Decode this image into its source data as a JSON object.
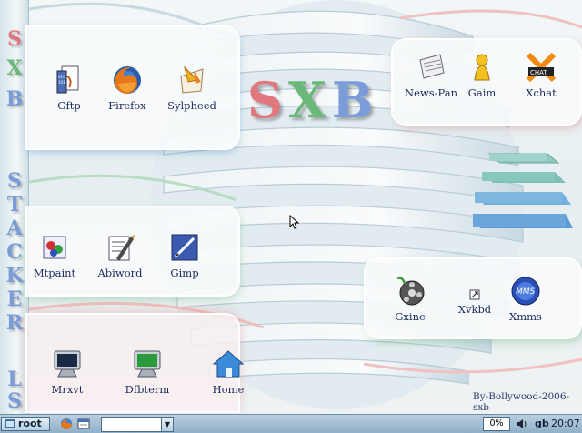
{
  "sidebar": {
    "letters": [
      "S",
      "X",
      "B",
      "S",
      "T",
      "A",
      "C",
      "K",
      "E",
      "R",
      "L",
      "S"
    ]
  },
  "logo": {
    "letters": [
      "S",
      "X",
      "B"
    ],
    "colors": [
      "#e07880",
      "#6cb87a",
      "#7a9cd8"
    ]
  },
  "panels": {
    "top_left": [
      {
        "label": "Gftp",
        "icon": "gftp-icon"
      },
      {
        "label": "Firefox",
        "icon": "firefox-icon"
      },
      {
        "label": "Sylpheed",
        "icon": "sylpheed-icon"
      }
    ],
    "mid_left": [
      {
        "label": "Mtpaint",
        "icon": "mtpaint-icon"
      },
      {
        "label": "Abiword",
        "icon": "abiword-icon"
      },
      {
        "label": "Gimp",
        "icon": "gimp-icon"
      }
    ],
    "bottom_left": [
      {
        "label": "Mrxvt",
        "icon": "terminal-icon"
      },
      {
        "label": "Dfbterm",
        "icon": "terminal-green-icon"
      },
      {
        "label": "Home",
        "icon": "home-icon"
      }
    ],
    "top_right": [
      {
        "label": "News-Pan",
        "icon": "newspan-icon"
      },
      {
        "label": "Gaim",
        "icon": "gaim-icon"
      },
      {
        "label": "Xchat",
        "icon": "xchat-icon"
      }
    ],
    "bottom_right": [
      {
        "label": "Gxine",
        "icon": "gxine-icon"
      },
      {
        "label": "Xvkbd",
        "icon": "xvkbd-icon"
      },
      {
        "label": "Xmms",
        "icon": "xmms-icon"
      }
    ]
  },
  "byline": "By-Bollywood-2006-sxb",
  "taskbar": {
    "start_label": "root",
    "combo_value": "",
    "cpu_usage": "0%",
    "keyboard_layout": "gb",
    "clock": "20:07"
  },
  "colors": {
    "taskbar": "#a6c2d6",
    "label_text": "#1c2a5a",
    "accent_red": "#e07880",
    "accent_green": "#6cb87a",
    "accent_blue": "#7a9cd8"
  }
}
